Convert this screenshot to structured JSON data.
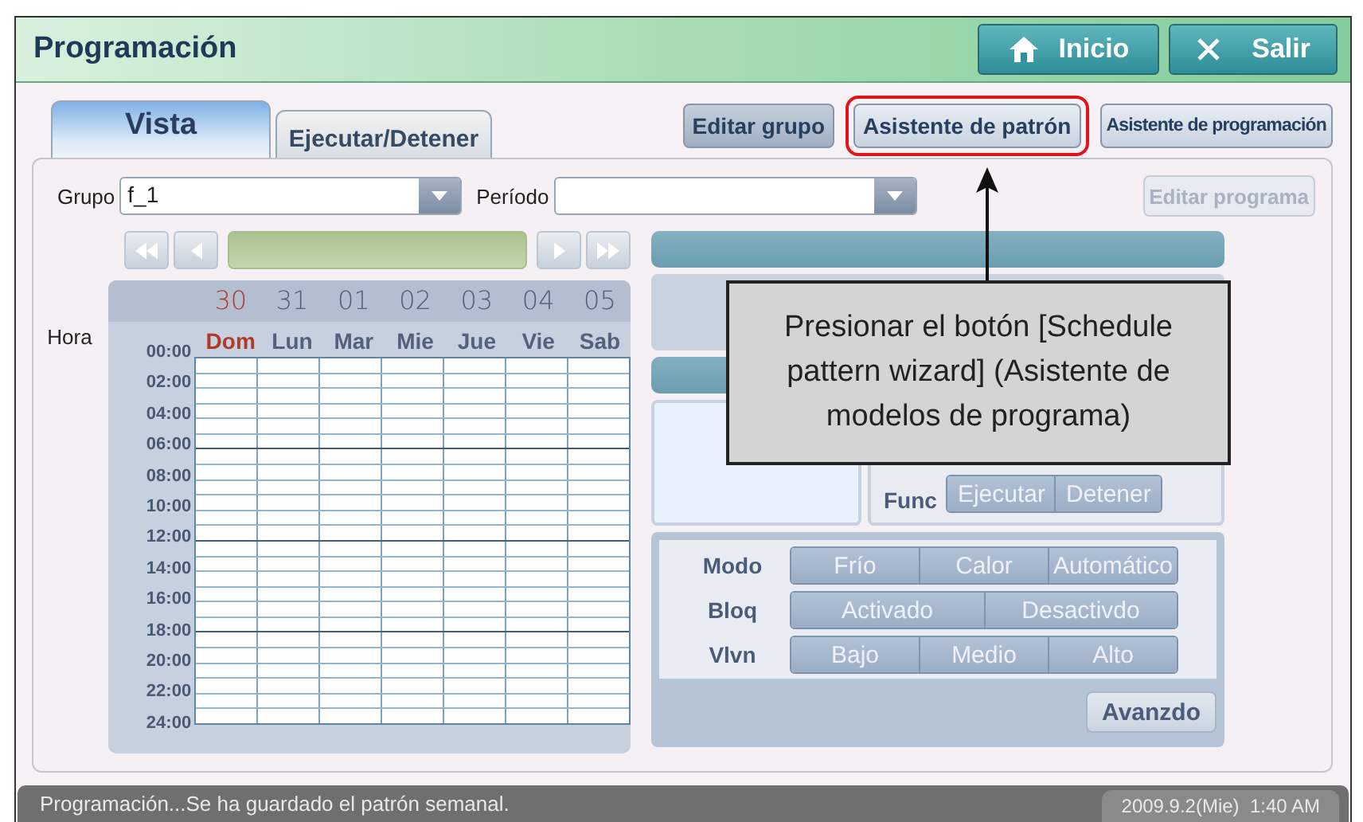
{
  "window": {
    "title": "Programación"
  },
  "header_buttons": [
    {
      "label": "Inicio",
      "kind": "home"
    },
    {
      "label": "Salir",
      "kind": "close"
    }
  ],
  "tabs": [
    {
      "label": "Vista",
      "selected": true
    },
    {
      "label": "Ejecutar/Detener",
      "selected": false
    }
  ],
  "toolbar_buttons": [
    {
      "label": "Editar grupo",
      "highlighted": false
    },
    {
      "label": "Asistente de patrón",
      "highlighted": true
    },
    {
      "label": "Asistente de programación",
      "highlighted": false
    }
  ],
  "group": {
    "label": "Grupo",
    "value": "f_1"
  },
  "period": {
    "label": "Período"
  },
  "edit_program": {
    "label": "Editar programa",
    "disabled": true
  },
  "calendar": {
    "hour_label": "Hora",
    "days": [
      {
        "date": "30",
        "name": "Dom",
        "holiday": true
      },
      {
        "date": "31",
        "name": "Lun",
        "holiday": false
      },
      {
        "date": "01",
        "name": "Mar",
        "holiday": false
      },
      {
        "date": "02",
        "name": "Mie",
        "holiday": false
      },
      {
        "date": "03",
        "name": "Jue",
        "holiday": false
      },
      {
        "date": "04",
        "name": "Vie",
        "holiday": false
      },
      {
        "date": "05",
        "name": "Sab",
        "holiday": false
      }
    ],
    "hours": [
      "00:00",
      "02:00",
      "04:00",
      "06:00",
      "08:00",
      "10:00",
      "12:00",
      "14:00",
      "16:00",
      "18:00",
      "20:00",
      "22:00",
      "24:00"
    ]
  },
  "func": {
    "label": "Func",
    "options": [
      "Ejecutar",
      "Detener"
    ]
  },
  "settings": [
    {
      "label": "Modo",
      "options": [
        "Frío",
        "Calor",
        "Automático"
      ]
    },
    {
      "label": "Bloq",
      "options": [
        "Activado",
        "Desactivdo"
      ]
    },
    {
      "label": "Vlvn",
      "options": [
        "Bajo",
        "Medio",
        "Alto"
      ]
    }
  ],
  "advanced_button": "Avanzdo",
  "callout": {
    "text": "Presionar el botón [Schedule pattern wizard] (Asistente de modelos de programa)"
  },
  "status_bar": {
    "message": "Programación...Se ha guardado el patrón semanal.",
    "datetime": "2009.9.2(Mie)  1:40 AM"
  }
}
